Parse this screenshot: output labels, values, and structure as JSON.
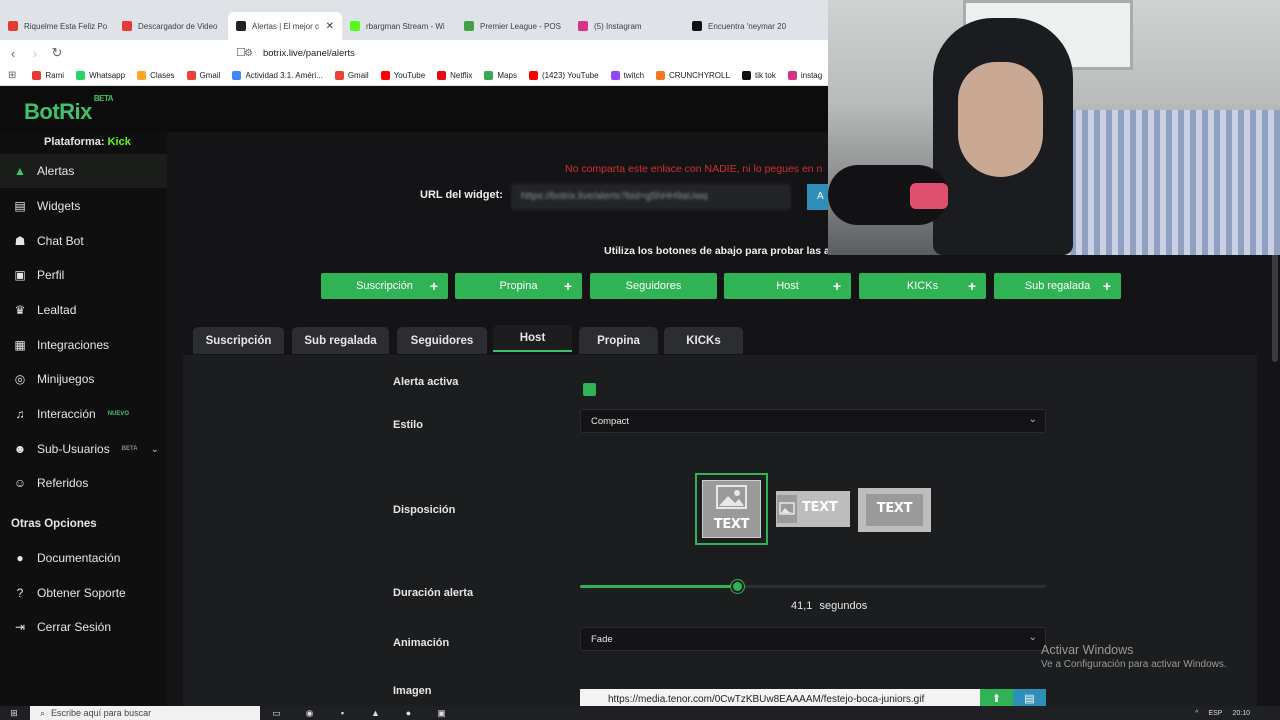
{
  "browser": {
    "tabs": [
      {
        "label": "Riquelme Esta Feliz Po",
        "color": "#e53935",
        "active": false
      },
      {
        "label": "Descargador de Video",
        "color": "#e53935",
        "active": false
      },
      {
        "label": "Alertas | El mejor c",
        "color": "#202124",
        "active": true
      },
      {
        "label": "rbargman Stream - Wi",
        "color": "#53fc18",
        "active": false
      },
      {
        "label": "Premier League - POS",
        "color": "#43a047",
        "active": false
      },
      {
        "label": "(5) Instagram",
        "color": "#d63384",
        "active": false
      },
      {
        "label": "Encuentra 'neymar 20",
        "color": "#111111",
        "active": false
      }
    ],
    "url": "botrix.live/panel/alerts",
    "bookmarks": [
      {
        "label": "Rami",
        "color": "#e53935"
      },
      {
        "label": "Whatsapp",
        "color": "#25d366"
      },
      {
        "label": "Clases",
        "color": "#f9a825"
      },
      {
        "label": "Gmail",
        "color": "#ea4335"
      },
      {
        "label": "Actividad 3.1. Améri...",
        "color": "#4285f4"
      },
      {
        "label": "Gmail",
        "color": "#ea4335"
      },
      {
        "label": "YouTube",
        "color": "#ff0000"
      },
      {
        "label": "Netflix",
        "color": "#e50914"
      },
      {
        "label": "Maps",
        "color": "#34a853"
      },
      {
        "label": "(1423) YouTube",
        "color": "#ff0000"
      },
      {
        "label": "twitch",
        "color": "#9146ff"
      },
      {
        "label": "CRUNCHYROLL",
        "color": "#f47521"
      },
      {
        "label": "tik tok",
        "color": "#111111"
      },
      {
        "label": "instag",
        "color": "#d63384"
      }
    ]
  },
  "brand": {
    "name": "BotRix",
    "tag": "BETA",
    "accent": "#3ec36a"
  },
  "sidebar": {
    "platform_label": "Plataforma:",
    "platform_value": "Kick",
    "items": [
      {
        "label": "Alertas",
        "icon": "warning-icon",
        "glyph": "▲",
        "active": true
      },
      {
        "label": "Widgets",
        "icon": "widgets-icon",
        "glyph": "▤"
      },
      {
        "label": "Chat Bot",
        "icon": "robot-icon",
        "glyph": "☗"
      },
      {
        "label": "Perfil",
        "icon": "id-card-icon",
        "glyph": "▣"
      },
      {
        "label": "Lealtad",
        "icon": "trophy-icon",
        "glyph": "♛"
      },
      {
        "label": "Integraciones",
        "icon": "integrations-icon",
        "glyph": "▦"
      },
      {
        "label": "Minijuegos",
        "icon": "gamepad-icon",
        "glyph": "◎"
      },
      {
        "label": "Interacción",
        "icon": "music-icon",
        "glyph": "♫",
        "badge": "NUEVO"
      },
      {
        "label": "Sub-Usuarios",
        "icon": "users-icon",
        "glyph": "☻",
        "badge": "BETA"
      },
      {
        "label": "Referidos",
        "icon": "referrals-icon",
        "glyph": "☺"
      }
    ],
    "section_title": "Otras Opciones",
    "other_items": [
      {
        "label": "Documentación",
        "icon": "document-icon",
        "glyph": "●"
      },
      {
        "label": "Obtener Soporte",
        "icon": "help-icon",
        "glyph": "?"
      },
      {
        "label": "Cerrar Sesión",
        "icon": "logout-icon",
        "glyph": "⇥"
      }
    ]
  },
  "main": {
    "warning": "No comparta este enlace con NADIE, ni lo pegues en n",
    "widget_label": "URL del widget:",
    "widget_url": "https://botrix.live/alerts?bid=g5hHH9aUwq",
    "apply_label": "A",
    "test_hint": "Utiliza los botones de abajo para probar las ale",
    "test_buttons": [
      {
        "label": "Suscripción",
        "plus": true
      },
      {
        "label": "Propina",
        "plus": true
      },
      {
        "label": "Seguidores",
        "plus": false
      },
      {
        "label": "Host",
        "plus": true
      },
      {
        "label": "KICKs",
        "plus": true
      },
      {
        "label": "Sub regalada",
        "plus": true
      }
    ],
    "tabs": [
      {
        "label": "Suscripción",
        "active": false
      },
      {
        "label": "Sub regalada",
        "active": false
      },
      {
        "label": "Seguidores",
        "active": false
      },
      {
        "label": "Host",
        "active": true
      },
      {
        "label": "Propina",
        "active": false
      },
      {
        "label": "KICKs",
        "active": false
      }
    ],
    "form": {
      "active_label": "Alerta activa",
      "active_checked": true,
      "style_label": "Estilo",
      "style_value": "Compact",
      "layout_label": "Disposición",
      "layout_text": "TEXT",
      "layout_selected_index": 0,
      "duration_label": "Duración alerta",
      "duration_value": "41,1",
      "duration_unit": "segundos",
      "duration_fraction": 0.337,
      "animation_label": "Animación",
      "animation_value": "Fade",
      "image_label": "Imagen",
      "image_url": "https://media.tenor.com/0CwTzKBUw8EAAAAM/festejo-boca-juniors.gif"
    }
  },
  "windows_activation": {
    "title": "Activar Windows",
    "subtitle": "Ve a Configuración para activar Windows."
  },
  "taskbar": {
    "search_placeholder": "Escribe aquí para buscar",
    "lang": "ESP",
    "time": "20:10"
  }
}
